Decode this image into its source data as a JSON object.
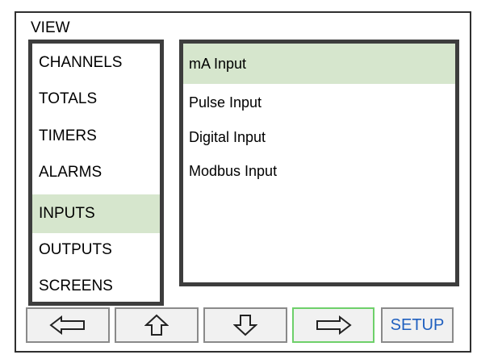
{
  "header": {
    "title": "VIEW"
  },
  "menu": {
    "items": [
      {
        "label": "CHANNELS",
        "selected": false
      },
      {
        "label": "TOTALS",
        "selected": false
      },
      {
        "label": "TIMERS",
        "selected": false
      },
      {
        "label": "ALARMS",
        "selected": false
      },
      {
        "label": "INPUTS",
        "selected": true
      },
      {
        "label": "OUTPUTS",
        "selected": false
      },
      {
        "label": "SCREENS",
        "selected": false
      }
    ]
  },
  "submenu": {
    "items": [
      {
        "label": "mA Input",
        "selected": true
      },
      {
        "label": "Pulse Input",
        "selected": false
      },
      {
        "label": "Digital Input",
        "selected": false
      },
      {
        "label": "Modbus Input",
        "selected": false
      }
    ]
  },
  "buttons": {
    "left_icon": "arrow-left-icon",
    "up_icon": "arrow-up-icon",
    "down_icon": "arrow-down-icon",
    "right_icon": "arrow-right-icon",
    "setup_label": "SETUP"
  },
  "colors": {
    "selection": "#d6e6cd",
    "panel_border": "#3d3d3d",
    "active_button_border": "#6ed06a",
    "setup_text": "#1f5fbf"
  }
}
